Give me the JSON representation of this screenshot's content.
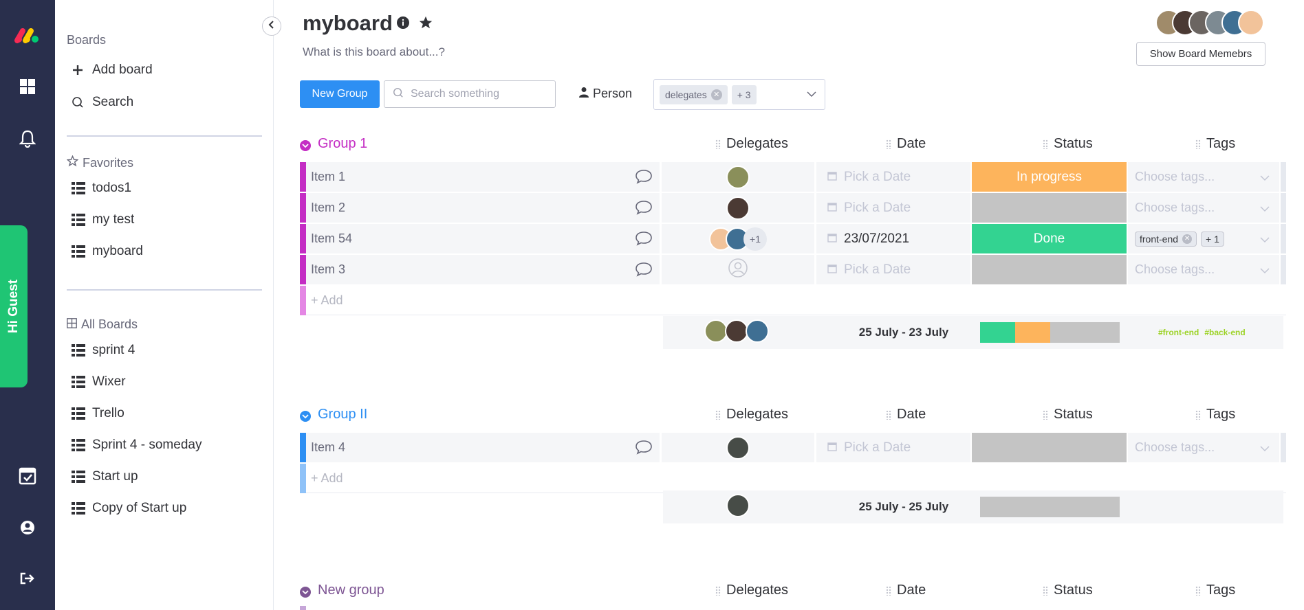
{
  "sidebar": {
    "guest_label": "Hi Guest",
    "boards_header": "Boards",
    "add_board": "Add board",
    "search": "Search",
    "favorites_header": "Favorites",
    "favorites": [
      {
        "label": "todos1"
      },
      {
        "label": "my test"
      },
      {
        "label": "myboard"
      }
    ],
    "all_boards_header": "All Boards",
    "all_boards": [
      {
        "label": "sprint 4"
      },
      {
        "label": "Wixer"
      },
      {
        "label": "Trello"
      },
      {
        "label": "Sprint 4 - someday"
      },
      {
        "label": "Start up"
      },
      {
        "label": "Copy of Start up"
      }
    ]
  },
  "board": {
    "title": "myboard",
    "description": "What is this board about...?",
    "show_members": "Show Board Memebrs"
  },
  "toolbar": {
    "new_group": "New Group",
    "search_placeholder": "Search something",
    "person": "Person",
    "filter_chip": "delegates",
    "filter_more": "+ 3"
  },
  "columns": {
    "delegates": "Delegates",
    "date": "Date",
    "status": "Status",
    "tags": "Tags"
  },
  "colors": {
    "group1": "#bb3354",
    "group1_title": "#c42dc4",
    "group2": "#2d8ff3",
    "group3": "#7e5694",
    "done": "#33d391",
    "progress": "#fdb45c",
    "empty": "#c4c4c4"
  },
  "groups": [
    {
      "title": "Group 1",
      "items": [
        {
          "name": "Item 1",
          "date": "Pick a Date",
          "status": "In progress",
          "tags": "Choose tags..."
        },
        {
          "name": "Item 2",
          "date": "Pick a Date",
          "status": "",
          "tags": "Choose tags..."
        },
        {
          "name": "Item 54",
          "date": "23/07/2021",
          "status": "Done",
          "delegates_more": "+1",
          "tag_chip": "front-end",
          "tag_more": "+ 1"
        },
        {
          "name": "Item 3",
          "date": "Pick a Date",
          "status": "",
          "tags": "Choose tags..."
        }
      ],
      "add": "+ Add",
      "summary": {
        "date_range": "25 July - 23 July",
        "tags": [
          "#front-end",
          "#back-end"
        ],
        "status_bar": [
          {
            "status": "Done",
            "fraction": 0.25
          },
          {
            "status": "In progress",
            "fraction": 0.25
          },
          {
            "status": "",
            "fraction": 0.5
          }
        ]
      }
    },
    {
      "title": "Group II",
      "items": [
        {
          "name": "Item 4",
          "date": "Pick a Date",
          "status": "",
          "tags": "Choose tags..."
        }
      ],
      "add": "+ Add",
      "summary": {
        "date_range": "25 July - 25 July"
      }
    },
    {
      "title": "New group"
    }
  ]
}
